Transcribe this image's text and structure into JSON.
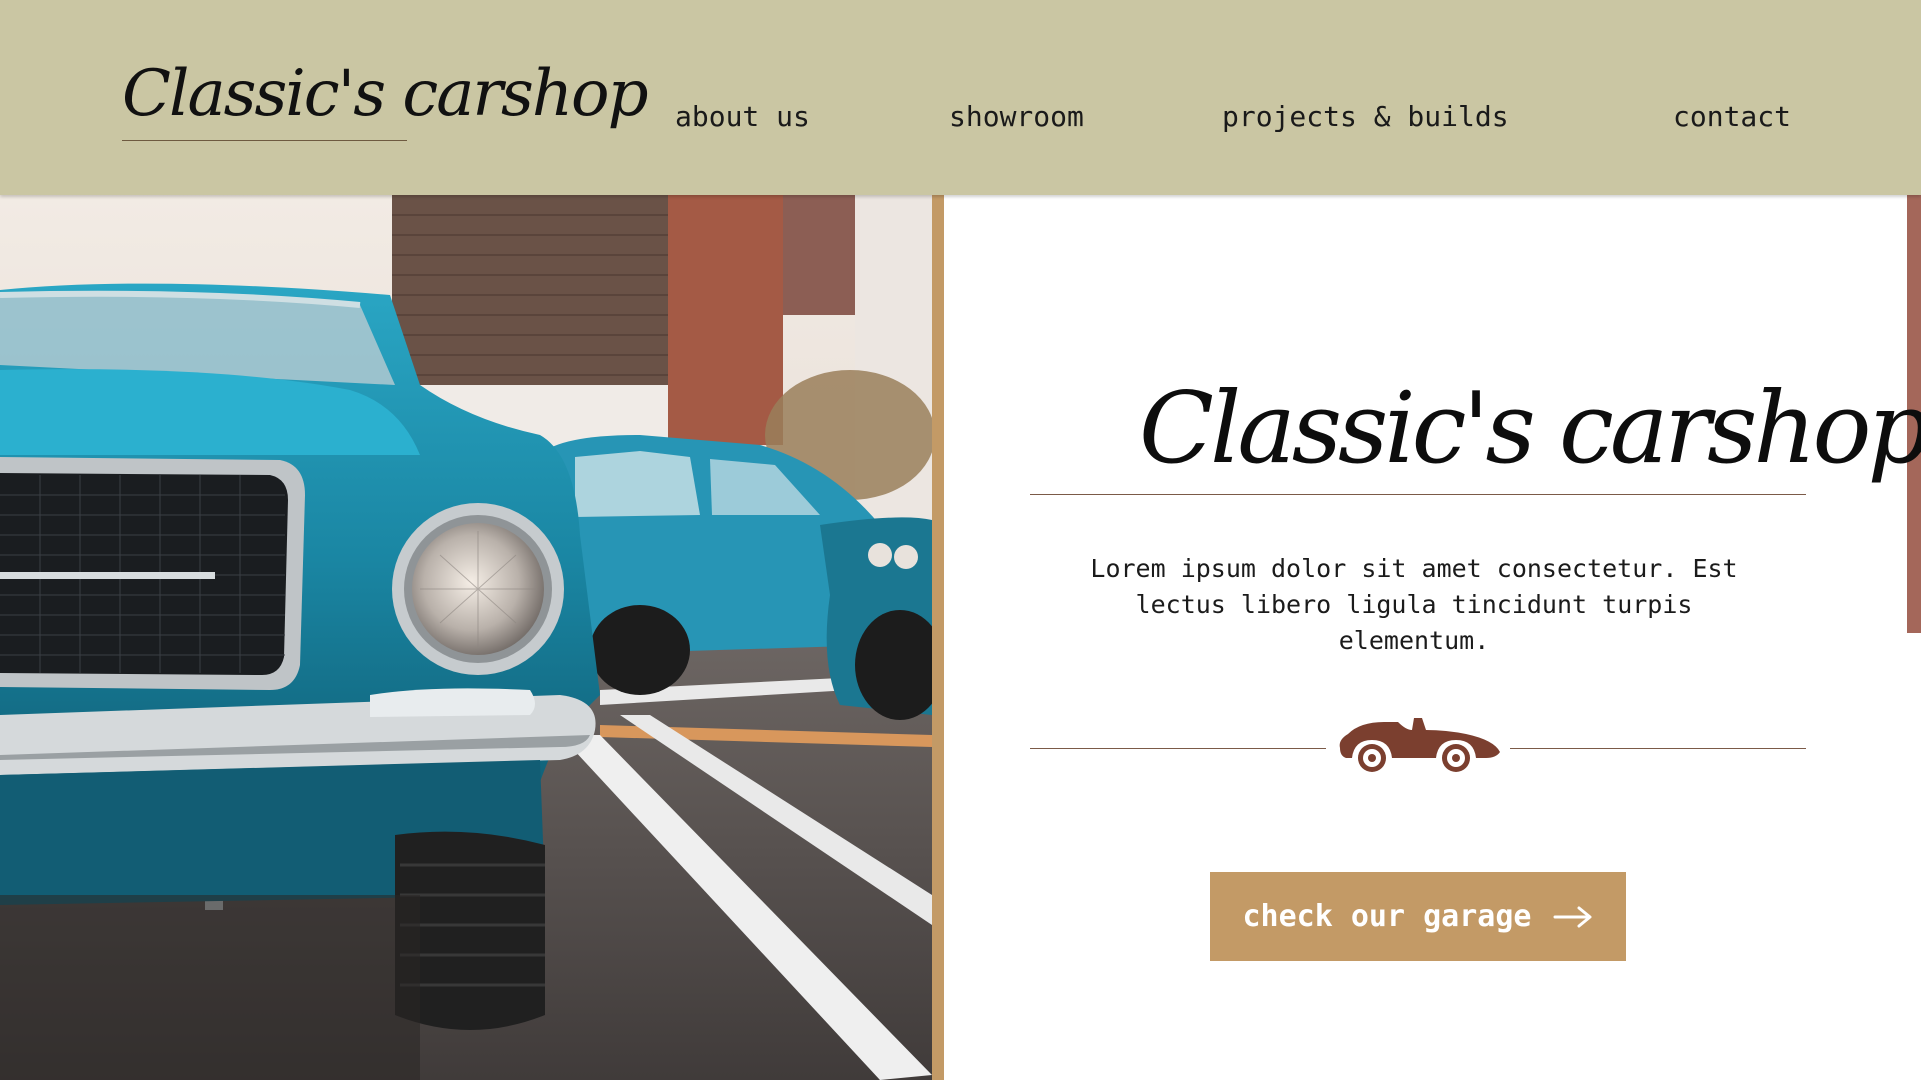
{
  "header": {
    "logo": "Classic's carshop",
    "nav": [
      {
        "label": "about us"
      },
      {
        "label": "showroom"
      },
      {
        "label": "projects & builds"
      },
      {
        "label": "contact"
      }
    ]
  },
  "hero": {
    "title": "Classic's carshop",
    "description": "Lorem ipsum dolor sit amet consectetur. Est lectus libero ligula tincidunt turpis elementum.",
    "divider_icon": "vintage-race-car-icon",
    "cta_label": "check our garage",
    "cta_icon": "arrow-right-icon"
  },
  "photo": {
    "subject": "classic-car-photo"
  },
  "colors": {
    "header_bg": "#cac6a3",
    "accent_tan": "#c39a66",
    "accent_brown": "#7b3f2f",
    "accent_rose": "#a4675a",
    "car_body": "#1b8eab"
  }
}
